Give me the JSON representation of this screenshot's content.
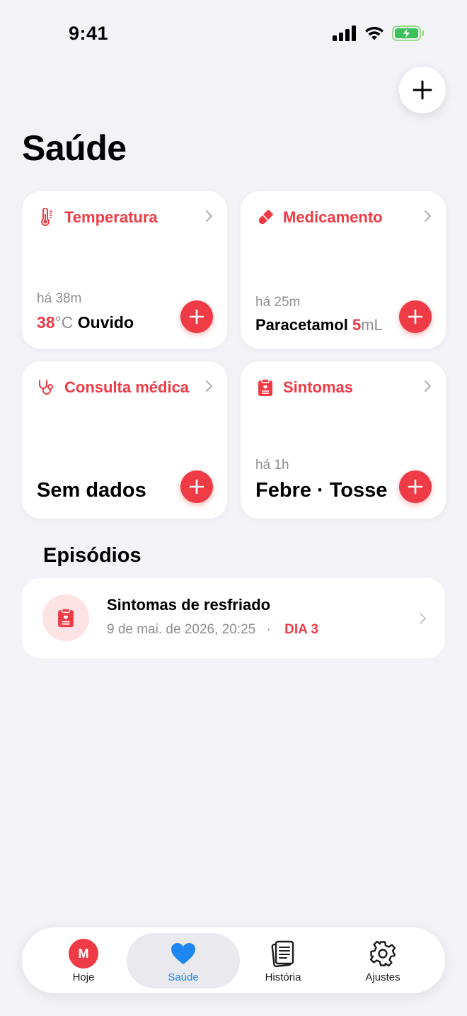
{
  "status": {
    "time": "9:41"
  },
  "page": {
    "title": "Saúde"
  },
  "cards": [
    {
      "title": "Temperatura",
      "subtitle": "há 38m",
      "value_num": "38",
      "value_unit": "°C",
      "value_text": "Ouvido",
      "icon": "thermometer-icon"
    },
    {
      "title": "Medicamento",
      "subtitle": "há 25m",
      "value_text": "Paracetamol",
      "value_num": "5",
      "value_unit": "mL",
      "icon": "pill-icon"
    },
    {
      "title": "Consulta médica",
      "value_text": "Sem dados",
      "icon": "stethoscope-icon"
    },
    {
      "title": "Sintomas",
      "subtitle": "há 1h",
      "value_text": "Febre · Tosse",
      "icon": "clipboard-icon"
    }
  ],
  "episodes": {
    "section_title": "Episódios",
    "items": [
      {
        "title": "Sintomas de resfriado",
        "date": "9 de mai. de 2026, 20:25",
        "separator": "·",
        "day": "DIA 3",
        "icon": "clipboard-icon"
      }
    ]
  },
  "tabbar": {
    "active": "Saúde",
    "tabs": [
      {
        "label": "Hoje",
        "avatar_letter": "M"
      },
      {
        "label": "Saúde",
        "icon": "heart-icon"
      },
      {
        "label": "História",
        "icon": "book-icon"
      },
      {
        "label": "Ajustes",
        "icon": "gear-icon"
      }
    ]
  },
  "colors": {
    "accent": "#EE3B45",
    "tab_active": "#1E88F0",
    "background": "#F2F2F7"
  }
}
